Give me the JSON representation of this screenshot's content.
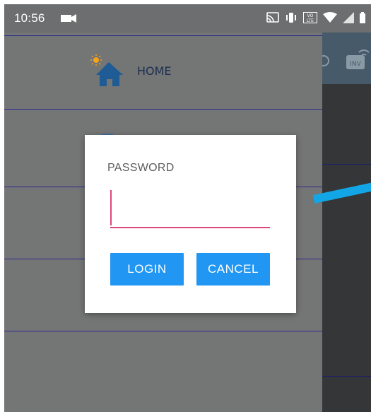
{
  "status_bar": {
    "time": "10:56",
    "icons": [
      "video-camera-icon",
      "cast-icon",
      "vibrate-icon",
      "volte-icon",
      "wifi-icon",
      "signal-icon",
      "battery-icon"
    ],
    "volte_label": "VO\nLTE"
  },
  "drawer": {
    "items": [
      {
        "label": "HOME",
        "icon": "home-icon"
      }
    ]
  },
  "dialog": {
    "title": "PASSWORD",
    "password_value": "",
    "login_label": "LOGIN",
    "cancel_label": "CANCEL"
  },
  "colors": {
    "accent": "#2196f3",
    "input_underline": "#e0457b",
    "drawer_bg": "#747575",
    "divider": "#2a2a8c",
    "pointer": "#12a6e6"
  }
}
